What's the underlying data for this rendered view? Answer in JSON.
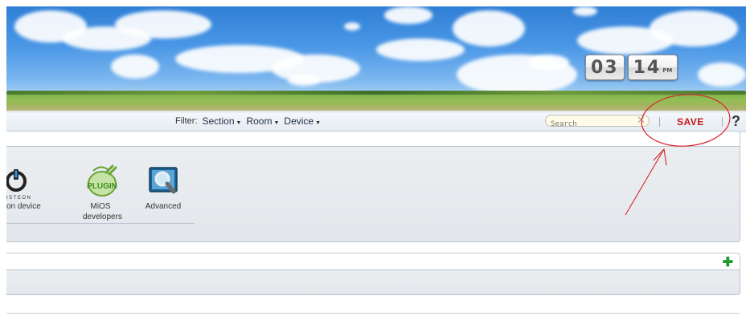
{
  "header": {
    "clock": {
      "hours": "03",
      "minutes": "14",
      "ampm": "PM"
    }
  },
  "filterbar": {
    "label": "Filter:",
    "dropdowns": [
      {
        "label": "Section"
      },
      {
        "label": "Room"
      },
      {
        "label": "Device"
      }
    ],
    "search_placeholder": "Search",
    "save_label": "SAVE",
    "help_label": "?"
  },
  "devices": [
    {
      "label": "on device",
      "icon": "insteon-power-icon",
      "icon_text": "ISTEON"
    },
    {
      "label": "MiOS developers",
      "icon": "plugin-icon",
      "icon_text": "PLUGIN"
    },
    {
      "label": "Advanced",
      "icon": "magnifier-monitor-icon"
    }
  ],
  "colors": {
    "save": "#c8161d",
    "annotation": "#d9242b",
    "add": "#1a9a2a"
  }
}
